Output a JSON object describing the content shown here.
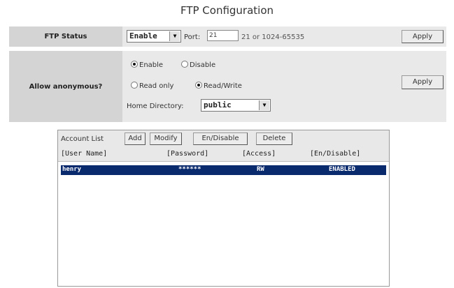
{
  "page_title": "FTP Configuration",
  "ftp_status": {
    "label": "FTP Status",
    "select_value": "Enable",
    "port_label": "Port:",
    "port_value": "21",
    "port_hint": "21 or 1024-65535",
    "apply_label": "Apply"
  },
  "anonymous": {
    "label": "Allow anonymous?",
    "enable_label": "Enable",
    "disable_label": "Disable",
    "read_only_label": "Read only",
    "read_write_label": "Read/Write",
    "home_dir_label": "Home Directory:",
    "home_dir_value": "public",
    "apply_label": "Apply"
  },
  "account_list": {
    "title": "Account List",
    "buttons": {
      "add": "Add",
      "modify": "Modify",
      "en_disable": "En/Disable",
      "delete": "Delete"
    },
    "columns": [
      "[User Name]",
      "[Password]",
      "[Access]",
      "[En/Disable]"
    ],
    "rows": [
      {
        "user": "henry",
        "password": "******",
        "access": "RW",
        "status": "ENABLED"
      }
    ]
  },
  "colors": {
    "selected_row": "#0a2a6e",
    "row_bg": "#e9e9e9",
    "label_bg": "#d4d4d4"
  }
}
